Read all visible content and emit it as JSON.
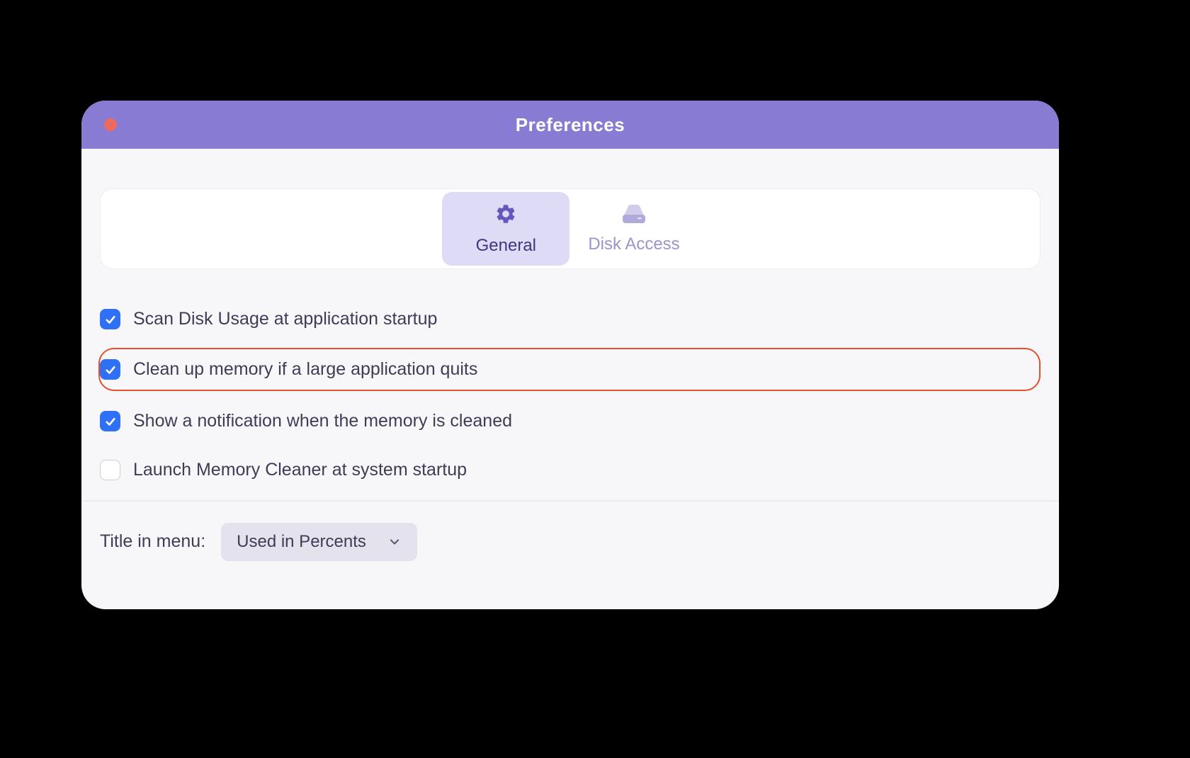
{
  "window": {
    "title": "Preferences"
  },
  "tabs": [
    {
      "label": "General",
      "icon": "gear-icon",
      "active": true
    },
    {
      "label": "Disk Access",
      "icon": "disk-icon",
      "active": false
    }
  ],
  "options": [
    {
      "label": "Scan Disk Usage at application startup",
      "checked": true,
      "highlighted": false
    },
    {
      "label": "Clean up memory if a large application quits",
      "checked": true,
      "highlighted": true
    },
    {
      "label": "Show a notification when the memory is cleaned",
      "checked": true,
      "highlighted": false
    },
    {
      "label": "Launch Memory Cleaner at system startup",
      "checked": false,
      "highlighted": false
    }
  ],
  "dropdown": {
    "label": "Title in menu:",
    "value": "Used in Percents"
  },
  "colors": {
    "accent": "#887bd4",
    "checkbox": "#2f71f6",
    "highlight": "#e6502e"
  }
}
